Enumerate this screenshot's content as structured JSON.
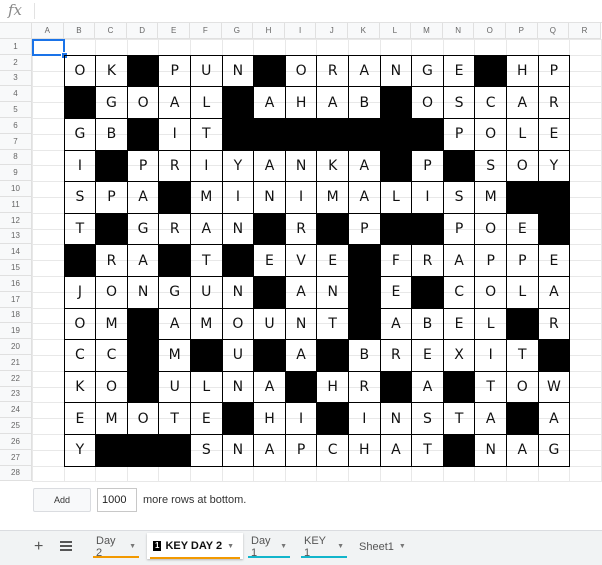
{
  "formula_bar": {
    "icon_label": "fx",
    "value": ""
  },
  "column_headers": [
    "A",
    "B",
    "C",
    "D",
    "E",
    "F",
    "G",
    "H",
    "I",
    "J",
    "K",
    "L",
    "M",
    "N",
    "O",
    "P",
    "Q",
    "R"
  ],
  "row_headers": [
    "1",
    "2",
    "3",
    "4",
    "5",
    "6",
    "7",
    "8",
    "9",
    "10",
    "11",
    "12",
    "13",
    "14",
    "15",
    "16",
    "17",
    "18",
    "19",
    "20",
    "21",
    "22",
    "23",
    "24",
    "25",
    "26",
    "27",
    "28"
  ],
  "selected_cell": "A1",
  "crossword": [
    [
      "O",
      "K",
      "#",
      "P",
      "U",
      "N",
      "#",
      "O",
      "R",
      "A",
      "N",
      "G",
      "E",
      "#",
      "H",
      "P"
    ],
    [
      "#",
      "G",
      "O",
      "A",
      "L",
      "#",
      "A",
      "H",
      "A",
      "B",
      "#",
      "O",
      "S",
      "C",
      "A",
      "R"
    ],
    [
      "G",
      "B",
      "#",
      "I",
      "T",
      "#",
      "#",
      "#",
      "#",
      "#",
      "#",
      "#",
      "P",
      "O",
      "L",
      "E"
    ],
    [
      "I",
      "#",
      "P",
      "R",
      "I",
      "Y",
      "A",
      "N",
      "K",
      "A",
      "#",
      "P",
      "#",
      "S",
      "O",
      "Y"
    ],
    [
      "S",
      "P",
      "A",
      "#",
      "M",
      "I",
      "N",
      "I",
      "M",
      "A",
      "L",
      "I",
      "S",
      "M",
      "#",
      "#"
    ],
    [
      "T",
      "#",
      "G",
      "R",
      "A",
      "N",
      "#",
      "R",
      "#",
      "P",
      "#",
      "#",
      "P",
      "O",
      "E",
      "#"
    ],
    [
      "#",
      "R",
      "A",
      "#",
      "T",
      "#",
      "E",
      "V",
      "E",
      "#",
      "F",
      "R",
      "A",
      "P",
      "P",
      "E"
    ],
    [
      "J",
      "O",
      "N",
      "G",
      "U",
      "N",
      "#",
      "A",
      "N",
      "#",
      "E",
      "#",
      "C",
      "O",
      "L",
      "A"
    ],
    [
      "O",
      "M",
      "#",
      "A",
      "M",
      "O",
      "U",
      "N",
      "T",
      "#",
      "A",
      "B",
      "E",
      "L",
      "#",
      "R"
    ],
    [
      "C",
      "C",
      "#",
      "M",
      "#",
      "U",
      "#",
      "A",
      "#",
      "B",
      "R",
      "E",
      "X",
      "I",
      "T",
      "#"
    ],
    [
      "K",
      "O",
      "#",
      "U",
      "L",
      "N",
      "A",
      "#",
      "H",
      "R",
      "#",
      "A",
      "#",
      "T",
      "O",
      "W"
    ],
    [
      "E",
      "M",
      "O",
      "T",
      "E",
      "#",
      "H",
      "I",
      "#",
      "I",
      "N",
      "S",
      "T",
      "A",
      "#",
      "A"
    ],
    [
      "Y",
      "#",
      "#",
      "#",
      "S",
      "N",
      "A",
      "P",
      "C",
      "H",
      "A",
      "T",
      "#",
      "N",
      "A",
      "G"
    ]
  ],
  "add_rows": {
    "button_label": "Add",
    "count": "1000",
    "suffix_text": "more rows at bottom."
  },
  "sheet_tabs": [
    {
      "label": "Day 2",
      "badge": "",
      "underline_color": "#f29900",
      "active": false
    },
    {
      "label": "KEY DAY 2",
      "badge": "1",
      "underline_color": "#f29900",
      "active": true
    },
    {
      "label": "Day 1",
      "badge": "",
      "underline_color": "#12b5cb",
      "active": false
    },
    {
      "label": "KEY 1",
      "badge": "",
      "underline_color": "#12b5cb",
      "active": false
    },
    {
      "label": "Sheet1",
      "badge": "",
      "underline_color": "",
      "active": false
    }
  ],
  "icons": {
    "add_sheet": "plus-icon",
    "all_sheets": "menu-icon",
    "tab_menu": "caret-down-icon"
  },
  "colors": {
    "selection": "#1a73e8",
    "black_square": "#000000"
  }
}
